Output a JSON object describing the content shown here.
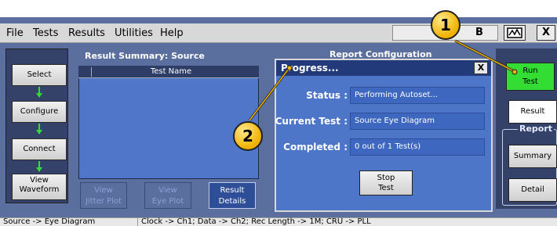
{
  "menu": {
    "items": [
      "File",
      "Tests",
      "Results",
      "Utilities",
      "Help"
    ],
    "right_text": "B",
    "sys_icon": "waveform-icon",
    "close_glyph": "X"
  },
  "left_nav": {
    "select": "Select",
    "configure": "Configure",
    "connect": "Connect",
    "view_waveform_line1": "View",
    "view_waveform_line2": "Waveform"
  },
  "result_summary": {
    "title": "Result Summary: Source",
    "column_header": "Test Name"
  },
  "plot_buttons": {
    "jitter_line1": "View",
    "jitter_line2": "Jitter Plot",
    "eye_line1": "View",
    "eye_line2": "Eye Plot",
    "details_line1": "Result",
    "details_line2": "Details"
  },
  "report_configuration_label": "Report Configuration",
  "right_panel": {
    "run_line1": "Run",
    "run_line2": "Test",
    "result": "Result",
    "report_group": "Report",
    "summary": "Summary",
    "detail": "Detail"
  },
  "dialog": {
    "title": "Progress...",
    "close": "X",
    "status_label": "Status :",
    "status_value": "Performing Autoset...",
    "current_test_label": "Current Test :",
    "current_test_value": "Source Eye Diagram",
    "completed_label": "Completed :",
    "completed_value": "0 out of 1 Test(s)",
    "stop_line1": "Stop",
    "stop_line2": "Test"
  },
  "status_bar": {
    "left": "Source -> Eye Diagram",
    "right": "Clock -> Ch1; Data -> Ch2; Rec Length -> 1M; CRU -> PLL"
  },
  "callouts": [
    "1",
    "2"
  ],
  "colors": {
    "run_button": "#33dd33",
    "callout": "#f0b000",
    "dialog_bg": "#4d75c8"
  }
}
